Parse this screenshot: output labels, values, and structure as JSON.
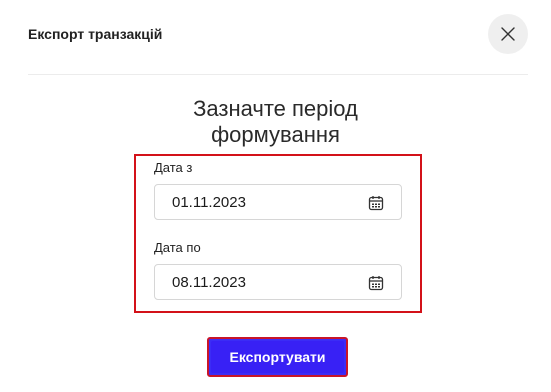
{
  "dialog": {
    "title": "Експорт транзакцій",
    "close_icon": "close-icon"
  },
  "period": {
    "heading_line1": "Зазначте період",
    "heading_line2": "формування",
    "from_label": "Дата з",
    "from_value": "01.11.2023",
    "to_label": "Дата по",
    "to_value": "08.11.2023",
    "calendar_icon": "calendar-icon"
  },
  "actions": {
    "export_label": "Експортувати"
  },
  "colors": {
    "highlight_border": "#d31119",
    "primary_button": "#3821f5"
  }
}
